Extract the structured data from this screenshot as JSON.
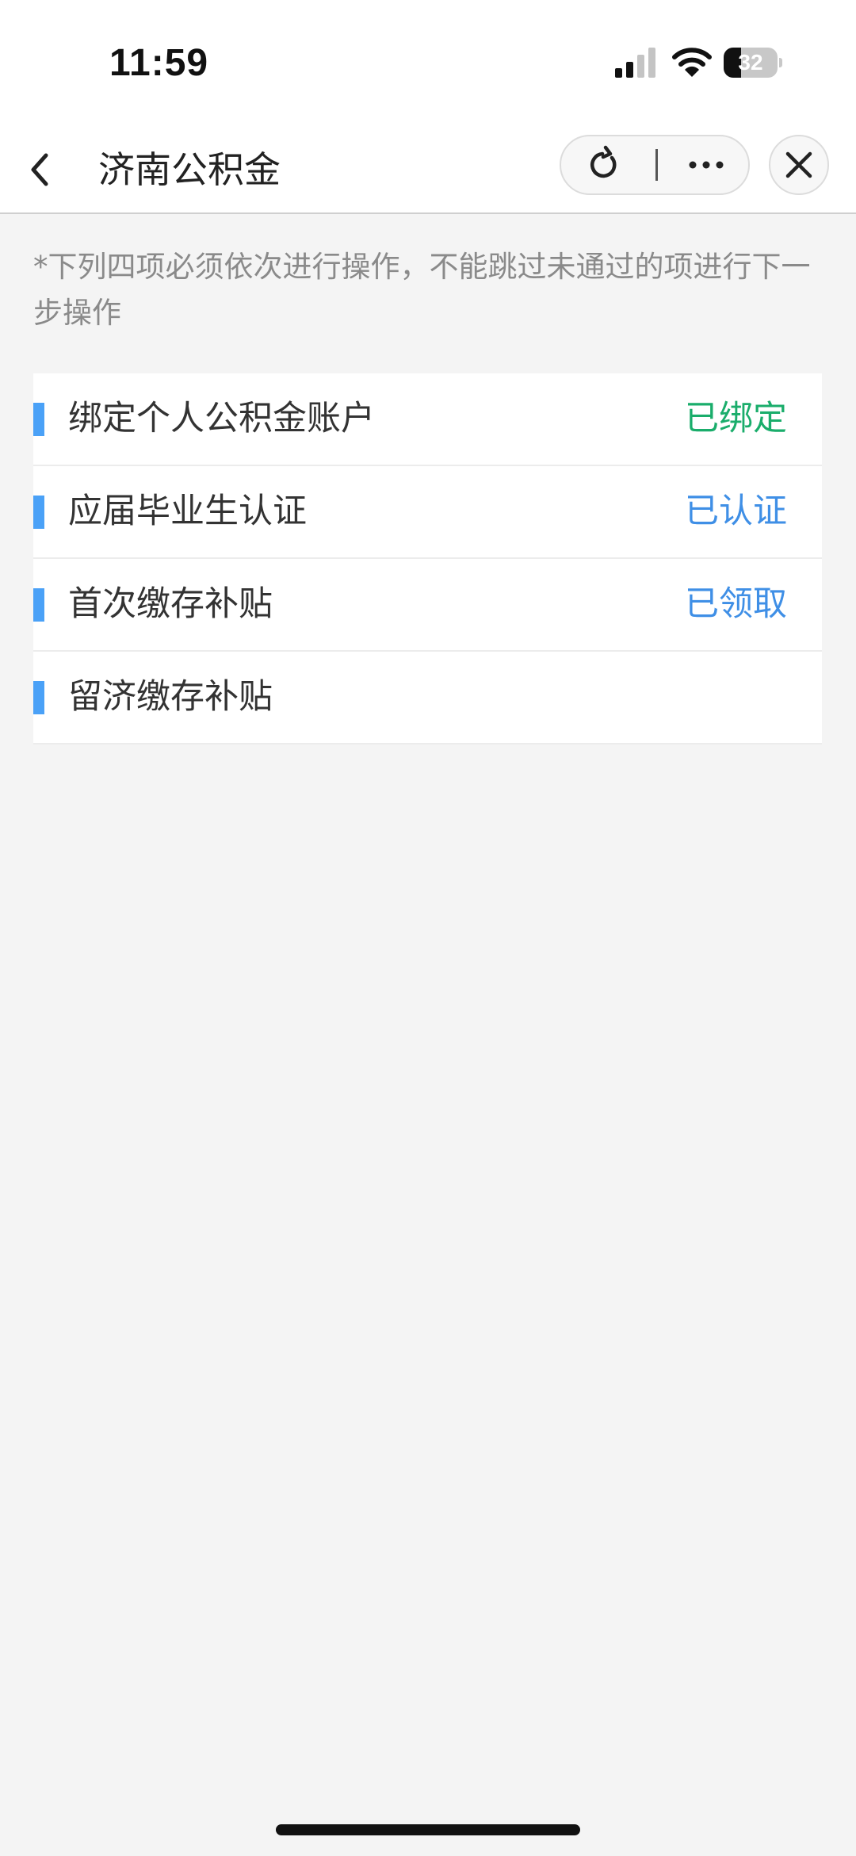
{
  "status_bar": {
    "time": "11:59",
    "battery": "32",
    "battery_level": 0.32
  },
  "nav": {
    "title": "济南公积金",
    "icons": {
      "back": "chevron-left-icon",
      "refresh": "refresh-icon",
      "more": "more-dots-icon",
      "close": "close-icon"
    }
  },
  "notice": "*下列四项必须依次进行操作，不能跳过未通过的项进行下一步操作",
  "steps": [
    {
      "label": "绑定个人公积金账户",
      "status": "已绑定",
      "status_color": "#1aad6b"
    },
    {
      "label": "应届毕业生认证",
      "status": "已认证",
      "status_color": "#3f8fe6"
    },
    {
      "label": "首次缴存补贴",
      "status": "已领取",
      "status_color": "#3f8fe6"
    },
    {
      "label": "留济缴存补贴",
      "status": "",
      "status_color": "#3f8fe6"
    }
  ],
  "colors": {
    "accent": "#4aa1f7",
    "background": "#f4f4f4"
  }
}
